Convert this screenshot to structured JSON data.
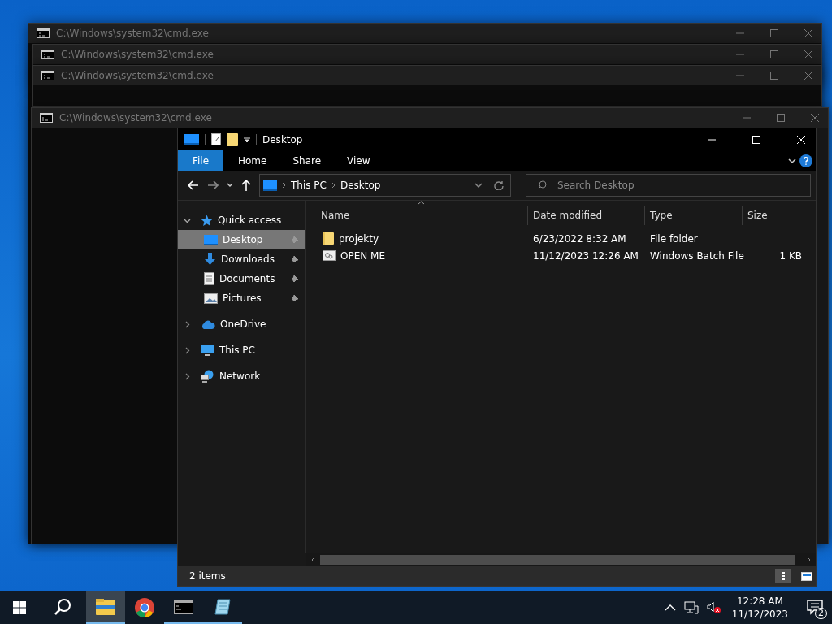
{
  "cmd_windows": [
    {
      "title": "C:\\Windows\\system32\\cmd.exe"
    },
    {
      "title": "C:\\Windows\\system32\\cmd.exe"
    },
    {
      "title": "C:\\Windows\\system32\\cmd.exe"
    },
    {
      "title": "C:\\Windows\\system32\\cmd.exe"
    }
  ],
  "explorer": {
    "title": "Desktop",
    "ribbon_tabs": [
      {
        "label": "File",
        "kind": "menu",
        "selected": false
      },
      {
        "label": "Home",
        "kind": "tab",
        "selected": false
      },
      {
        "label": "Share",
        "kind": "tab",
        "selected": false
      },
      {
        "label": "View",
        "kind": "tab",
        "selected": false
      }
    ],
    "breadcrumb": [
      "This PC",
      "Desktop"
    ],
    "search": {
      "placeholder": "Search Desktop"
    },
    "nav": [
      {
        "label": "Quick access",
        "kind": "star",
        "expanded": true,
        "children": [
          {
            "label": "Desktop",
            "kind": "desktop",
            "selected": true,
            "pinned": true
          },
          {
            "label": "Downloads",
            "kind": "download",
            "selected": false,
            "pinned": true
          },
          {
            "label": "Documents",
            "kind": "document",
            "selected": false,
            "pinned": true
          },
          {
            "label": "Pictures",
            "kind": "pictures",
            "selected": false,
            "pinned": true
          }
        ]
      },
      {
        "label": "OneDrive",
        "kind": "cloud",
        "expanded": false
      },
      {
        "label": "This PC",
        "kind": "pc",
        "expanded": false
      },
      {
        "label": "Network",
        "kind": "network",
        "expanded": false
      }
    ],
    "columns": [
      "Name",
      "Date modified",
      "Type",
      "Size"
    ],
    "rows": [
      {
        "kind": "folder",
        "name": "projekty",
        "date": "6/23/2022 8:32 AM",
        "type": "File folder"
      },
      {
        "kind": "batch",
        "name": "OPEN ME",
        "date": "11/12/2023 12:26 AM",
        "type": "Windows Batch File",
        "size": "1 KB"
      }
    ],
    "status": "2 items"
  },
  "taskbar": {
    "apps": [
      {
        "kind": "explorer",
        "active": true,
        "running": true
      },
      {
        "kind": "chrome",
        "active": false,
        "running": false
      },
      {
        "kind": "cmd",
        "active": false,
        "running": true
      },
      {
        "kind": "notepad",
        "active": false,
        "running": true
      }
    ],
    "time": "12:28 AM",
    "date": "11/12/2023",
    "notifications": "2"
  }
}
